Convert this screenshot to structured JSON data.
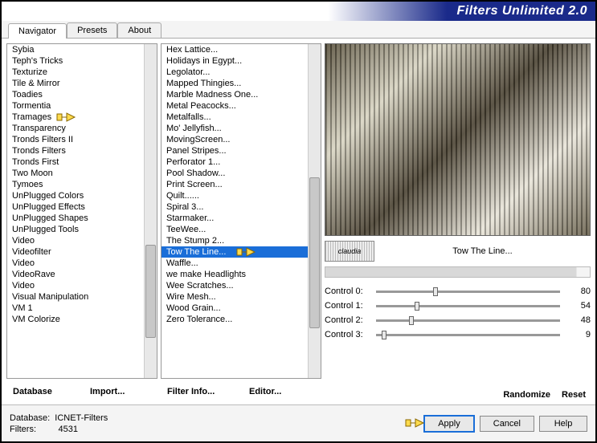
{
  "title": "Filters Unlimited 2.0",
  "tabs": [
    "Navigator",
    "Presets",
    "About"
  ],
  "active_tab": 0,
  "col1_items": [
    "Sybia",
    "Teph's Tricks",
    "Texturize",
    "Tile & Mirror",
    "Toadies",
    "Tormentia",
    "Tramages",
    "Transparency",
    "Tronds Filters II",
    "Tronds Filters",
    "Tronds First",
    "Two Moon",
    "Tymoes",
    "UnPlugged Colors",
    "UnPlugged Effects",
    "UnPlugged Shapes",
    "UnPlugged Tools",
    "Video",
    "Videofilter",
    "Video",
    "VideoRave",
    "Video",
    "Visual Manipulation",
    "VM 1",
    "VM Colorize"
  ],
  "col1_highlighted": 6,
  "col2_items": [
    "Hex Lattice...",
    "Holidays in Egypt...",
    "Legolator...",
    "Mapped Thingies...",
    "Marble Madness One...",
    "Metal Peacocks...",
    "Metalfalls...",
    "Mo' Jellyfish...",
    "MovingScreen...",
    "Panel Stripes...",
    "Perforator 1...",
    "Pool Shadow...",
    "Print Screen...",
    "Quilt......",
    "Spiral 3...",
    "Starmaker...",
    "TeeWee...",
    "The Stump 2...",
    "Tow The Line...",
    "Waffle...",
    "we make Headlights",
    "Wee Scratches...",
    "Wire Mesh...",
    "Wood Grain...",
    "Zero Tolerance..."
  ],
  "col2_selected": 18,
  "col1_buttons": {
    "database": "Database",
    "import": "Import..."
  },
  "col2_buttons": {
    "filter_info": "Filter Info...",
    "editor": "Editor..."
  },
  "right_buttons": {
    "randomize": "Randomize",
    "reset": "Reset"
  },
  "watermark_text": "claudia",
  "filter_name": "Tow The Line...",
  "controls": [
    {
      "label": "Control 0:",
      "value": 80,
      "pos": 31
    },
    {
      "label": "Control 1:",
      "value": 54,
      "pos": 21
    },
    {
      "label": "Control 2:",
      "value": 48,
      "pos": 18
    },
    {
      "label": "Control 3:",
      "value": 9,
      "pos": 3
    }
  ],
  "footer": {
    "db_label": "Database:",
    "db_value": "ICNET-Filters",
    "filters_label": "Filters:",
    "filters_value": "4531"
  },
  "footer_buttons": {
    "apply": "Apply",
    "cancel": "Cancel",
    "help": "Help"
  }
}
